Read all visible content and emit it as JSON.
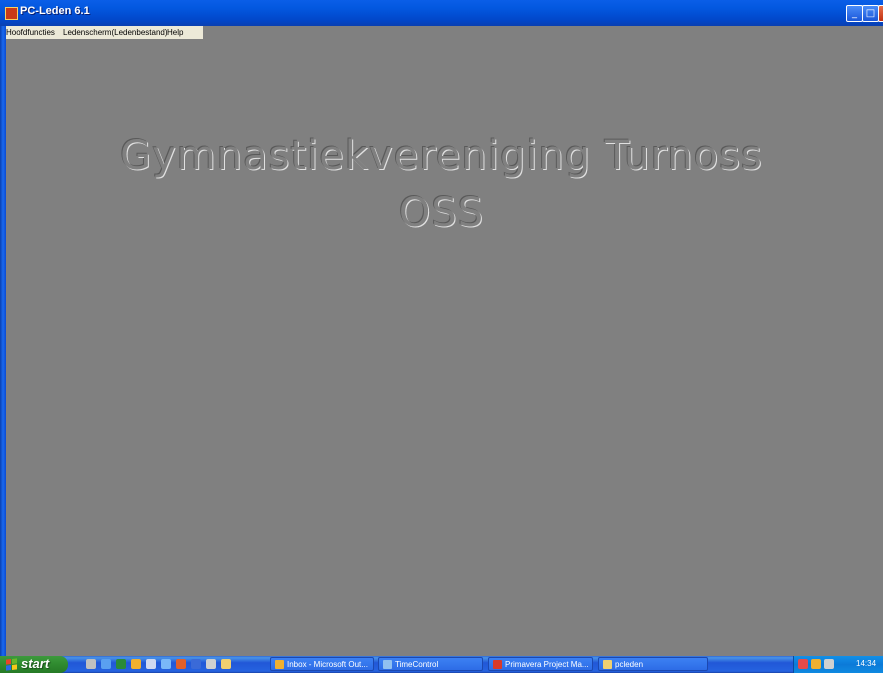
{
  "window": {
    "title": "PC-Leden 6.1",
    "controls": {
      "minimize": "_",
      "maximize": "□",
      "close": "×"
    }
  },
  "menu": [
    {
      "label": "Hoofdfuncties"
    },
    {
      "label": "Ledenscherm(Ledenbestand)"
    },
    {
      "label": "Help"
    }
  ],
  "main": {
    "organization_line1": "Gymnastiekvereniging Turnoss",
    "organization_line2": "OSS"
  },
  "taskbar": {
    "start_label": "start",
    "quick_launch": [
      {
        "icon": "terminal-icon",
        "color": "#c0c0c0"
      },
      {
        "icon": "internet-explorer-icon",
        "color": "#5aa0f0"
      },
      {
        "icon": "excel-icon",
        "color": "#2a8a3a"
      },
      {
        "icon": "outlook-icon",
        "color": "#f0b030"
      },
      {
        "icon": "notepad-icon",
        "color": "#d0d8f0"
      },
      {
        "icon": "sync-icon",
        "color": "#7ab8f8"
      },
      {
        "icon": "powerpoint-icon",
        "color": "#e0602a"
      },
      {
        "icon": "word-icon",
        "color": "#3a6ad8"
      },
      {
        "icon": "tool-icon",
        "color": "#d0d0d0"
      },
      {
        "icon": "folder-icon",
        "color": "#f0d070"
      }
    ],
    "tasks": [
      {
        "label": "Inbox - Microsoft Out...",
        "icon": "outlook-icon",
        "color": "#f0b030"
      },
      {
        "label": "TimeControl",
        "icon": "timecontrol-icon",
        "color": "#90c0f0"
      },
      {
        "label": "Primavera Project Ma...",
        "icon": "primavera-icon",
        "color": "#d83a2a"
      },
      {
        "label": "pcleden",
        "icon": "folder-icon",
        "color": "#f0d070"
      }
    ],
    "tray_icons": [
      {
        "icon": "network-icon",
        "color": "#e84a4a"
      },
      {
        "icon": "outlook-tray-icon",
        "color": "#f0b030"
      },
      {
        "icon": "speaker-icon",
        "color": "#d0d0d0"
      }
    ],
    "clock": "14:34"
  }
}
